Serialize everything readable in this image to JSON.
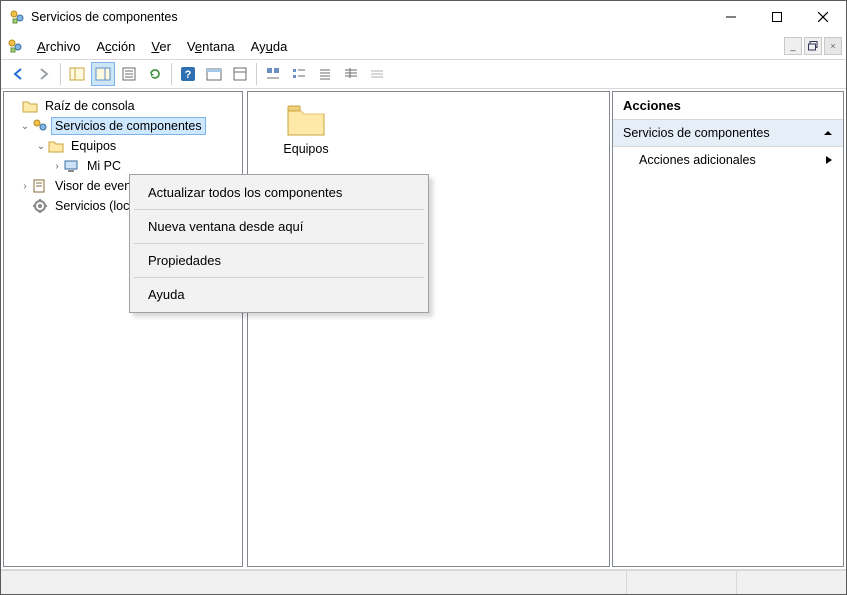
{
  "window": {
    "title": "Servicios de componentes"
  },
  "menubar": {
    "archivo": "Archivo",
    "accion": "Acción",
    "ver": "Ver",
    "ventana": "Ventana",
    "ayuda": "Ayuda"
  },
  "tree": {
    "root": "Raíz de consola",
    "comp_services": "Servicios de componentes",
    "equipos": "Equipos",
    "mi_pc": "Mi PC",
    "visor": "Visor de eventos",
    "servicios": "Servicios (local)"
  },
  "content": {
    "folder_label": "Equipos"
  },
  "actions": {
    "header": "Acciones",
    "group": "Servicios de componentes",
    "more": "Acciones adicionales"
  },
  "context_menu": {
    "refresh_all": "Actualizar todos los componentes",
    "new_window": "Nueva ventana desde aquí",
    "properties": "Propiedades",
    "help": "Ayuda"
  }
}
